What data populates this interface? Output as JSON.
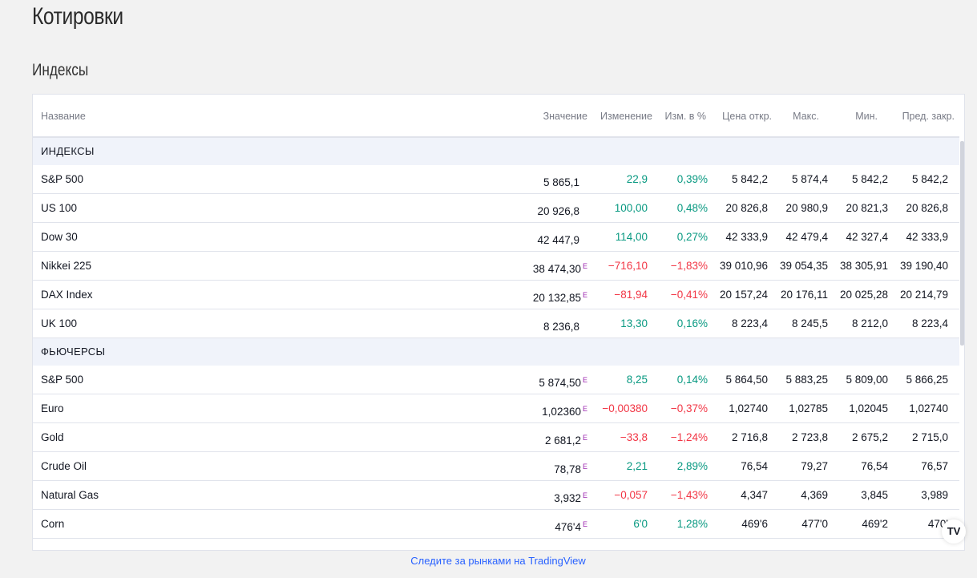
{
  "page": {
    "title": "Котировки",
    "section_title": "Индексы"
  },
  "table": {
    "columns": {
      "name": "Название",
      "value": "Значение",
      "change": "Изменение",
      "change_pct": "Изм. в %",
      "open": "Цена откр.",
      "high": "Макс.",
      "low": "Мин.",
      "prev_close": "Пред. закр."
    },
    "groups": [
      {
        "label": "ИНДЕКСЫ",
        "rows": [
          {
            "name": "S&P 500",
            "value": "5 865,1",
            "delayed": "",
            "change": "22,9",
            "change_pct": "0,39%",
            "open": "5 842,2",
            "high": "5 874,4",
            "low": "5 842,2",
            "prev_close": "5 842,2",
            "direction": "up"
          },
          {
            "name": "US 100",
            "value": "20 926,8",
            "delayed": "",
            "change": "100,00",
            "change_pct": "0,48%",
            "open": "20 826,8",
            "high": "20 980,9",
            "low": "20 821,3",
            "prev_close": "20 826,8",
            "direction": "up"
          },
          {
            "name": "Dow 30",
            "value": "42 447,9",
            "delayed": "",
            "change": "114,00",
            "change_pct": "0,27%",
            "open": "42 333,9",
            "high": "42 479,4",
            "low": "42 327,4",
            "prev_close": "42 333,9",
            "direction": "up"
          },
          {
            "name": "Nikkei 225",
            "value": "38 474,30",
            "delayed": "E",
            "change": "−716,10",
            "change_pct": "−1,83%",
            "open": "39 010,96",
            "high": "39 054,35",
            "low": "38 305,91",
            "prev_close": "39 190,40",
            "direction": "down"
          },
          {
            "name": "DAX Index",
            "value": "20 132,85",
            "delayed": "E",
            "change": "−81,94",
            "change_pct": "−0,41%",
            "open": "20 157,24",
            "high": "20 176,11",
            "low": "20 025,28",
            "prev_close": "20 214,79",
            "direction": "down"
          },
          {
            "name": "UK 100",
            "value": "8 236,8",
            "delayed": "",
            "change": "13,30",
            "change_pct": "0,16%",
            "open": "8 223,4",
            "high": "8 245,5",
            "low": "8 212,0",
            "prev_close": "8 223,4",
            "direction": "up"
          }
        ]
      },
      {
        "label": "ФЬЮЧЕРСЫ",
        "rows": [
          {
            "name": "S&P 500",
            "value": "5 874,50",
            "delayed": "E",
            "change": "8,25",
            "change_pct": "0,14%",
            "open": "5 864,50",
            "high": "5 883,25",
            "low": "5 809,00",
            "prev_close": "5 866,25",
            "direction": "up"
          },
          {
            "name": "Euro",
            "value": "1,02360",
            "delayed": "E",
            "change": "−0,00380",
            "change_pct": "−0,37%",
            "open": "1,02740",
            "high": "1,02785",
            "low": "1,02045",
            "prev_close": "1,02740",
            "direction": "down"
          },
          {
            "name": "Gold",
            "value": "2 681,2",
            "delayed": "E",
            "change": "−33,8",
            "change_pct": "−1,24%",
            "open": "2 716,8",
            "high": "2 723,8",
            "low": "2 675,2",
            "prev_close": "2 715,0",
            "direction": "down"
          },
          {
            "name": "Crude Oil",
            "value": "78,78",
            "delayed": "E",
            "change": "2,21",
            "change_pct": "2,89%",
            "open": "76,54",
            "high": "79,27",
            "low": "76,54",
            "prev_close": "76,57",
            "direction": "up"
          },
          {
            "name": "Natural Gas",
            "value": "3,932",
            "delayed": "E",
            "change": "−0,057",
            "change_pct": "−1,43%",
            "open": "4,347",
            "high": "4,369",
            "low": "3,845",
            "prev_close": "3,989",
            "direction": "down"
          },
          {
            "name": "Corn",
            "value": "476'4",
            "delayed": "E",
            "change": "6'0",
            "change_pct": "1,28%",
            "open": "469'6",
            "high": "477'0",
            "low": "469'2",
            "prev_close": "470'",
            "direction": "up"
          }
        ]
      }
    ]
  },
  "badge": {
    "label": "TV",
    "icon": "tradingview-logo-icon"
  },
  "footer": {
    "link_text": "Следите за рынками на TradingView"
  },
  "colors": {
    "positive": "#089981",
    "negative": "#f23645",
    "link": "#2962ff",
    "delayed_mark": "#9c27b0"
  }
}
